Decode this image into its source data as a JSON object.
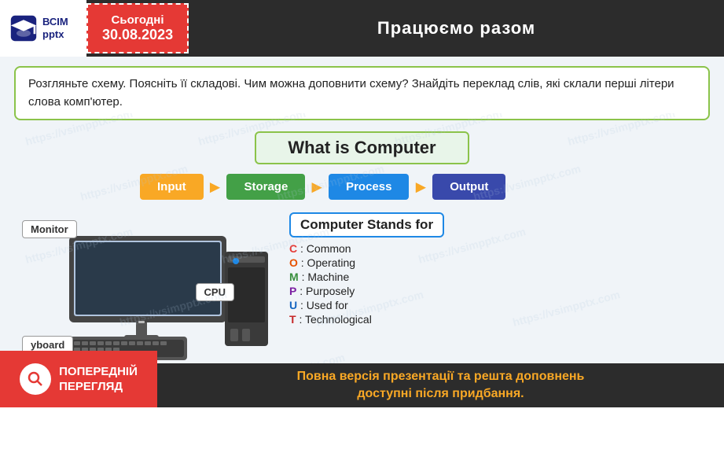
{
  "header": {
    "logo_lines": [
      "ВСІМ",
      "pptx"
    ],
    "today_label": "Сьогодні",
    "date_value": "30.08.2023",
    "title": "Працюємо разом"
  },
  "instruction": {
    "text": "Розгляньте схему. Поясніть її складові. Чим можна доповнити схему? Знайдіть переклад слів, які склали перші літери слова комп'ютер."
  },
  "diagram": {
    "title": "What is Computer",
    "flow": [
      {
        "label": "Input",
        "color": "#f9a825"
      },
      {
        "label": "Storage",
        "color": "#43a047"
      },
      {
        "label": "Process",
        "color": "#1e88e5"
      },
      {
        "label": "Output",
        "color": "#3949ab"
      }
    ]
  },
  "computer_labels": {
    "monitor": "Monitor",
    "cpu": "CPU",
    "keyboard": "yboard"
  },
  "stands_for": {
    "title": "Computer Stands for",
    "items": [
      {
        "letter": "C",
        "color_class": "c-color",
        "rest": ": Common"
      },
      {
        "letter": "O",
        "color_class": "o-color",
        "rest": ": Operating"
      },
      {
        "letter": "M",
        "color_class": "m-color",
        "rest": ": Machine"
      },
      {
        "letter": "P",
        "color_class": "p-color",
        "rest": ": Purposely"
      },
      {
        "letter": "U",
        "color_class": "u-color",
        "rest": ": Used for"
      },
      {
        "letter": "T",
        "color_class": "t-color",
        "rest": ": Technological"
      }
    ]
  },
  "preview": {
    "button_line1": "ПОПЕРЕДНІЙ",
    "button_line2": "ПЕРЕГЛЯД"
  },
  "bottom_bar": {
    "line1": "Повна версія презентації та решта доповнень",
    "line2": "доступні після придбання."
  },
  "watermark": "https://vsimpptx.com"
}
